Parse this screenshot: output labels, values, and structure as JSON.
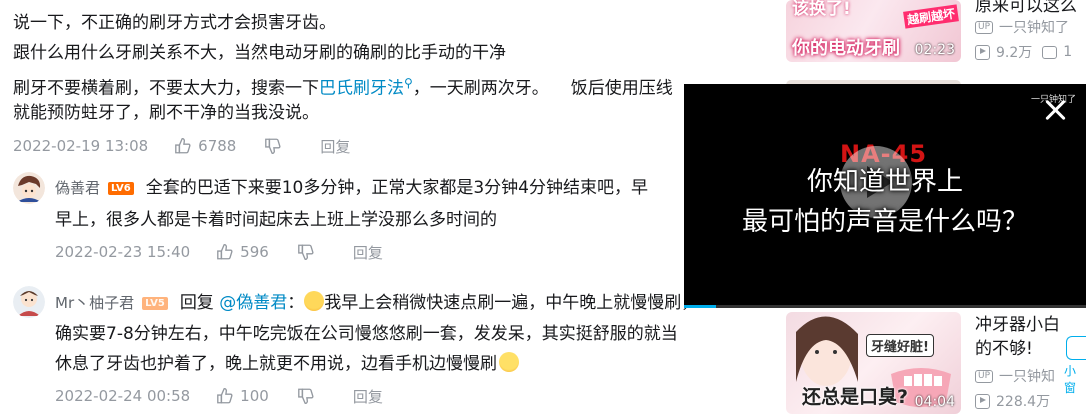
{
  "comment_tail": {
    "lines": [
      "说一下，不正确的刷牙方式才会损害牙齿。",
      "跟什么用什么牙刷关系不大，当然电动牙刷的确刷的比手动的干净",
      "就能预防蛀牙了，刷不干净的当我没说。"
    ],
    "line3_a": "刷牙不要横着刷，不要太大力，搜索一下",
    "line3_link": "巴氏刷牙法",
    "line3_b": "，一天刷两次牙。",
    "line3_c": "饭后使用压线",
    "date": "2022-02-19 13:08",
    "likes": "6788",
    "reply_label": "回复"
  },
  "replies": [
    {
      "username": "偽善君",
      "level": "LV6",
      "text_1": "全套的巴适下来要10多分钟，正常大家都是3分钟4分钟结束吧，早",
      "text_2": "早上，很多人都是卡着时间起床去上班上学没那么多时间的",
      "date": "2022-02-23 15:40",
      "likes": "596",
      "reply_label": "回复"
    },
    {
      "username": "Mr丶柚子君",
      "level": "LV5",
      "reply_prefix": "回复",
      "mention": "@偽善君",
      "colon": "：",
      "text_1": "我早上会稍微快速点刷一遍，中午晚上就慢慢刷，",
      "text_2": "确实要7-8分钟左右，中午吃完饭在公司慢悠悠刷一套，发发呆，其实挺舒服的就当",
      "text_3": "休息了牙齿也护着了，晚上就更不用说，边看手机边慢慢刷",
      "date": "2022-02-24 00:58",
      "likes": "100",
      "reply_label": "回复"
    }
  ],
  "recommendations": [
    {
      "title": "原来可以这么",
      "thumb_text_1": "该换了!",
      "thumb_text_2": "越刷越坏",
      "thumb_text_3": "你的电动牙刷",
      "duration": "02:23",
      "up_badge": "UP",
      "uploader": "一只钟知了",
      "views": "9.2万",
      "danmaku": "1"
    },
    {
      "title_1": "冲牙器小白",
      "title_2": "的不够!",
      "thumb_text_1": "牙缝好脏!",
      "thumb_text_2": "还总是口臭?",
      "duration": "04:04",
      "up_badge": "UP",
      "uploader": "一只钟知",
      "views": "228.4万",
      "side_label": "小窗"
    }
  ],
  "mini_player": {
    "watermark": "一只钟知了",
    "code_text": "NA-45",
    "subtitle_1": "你知道世界上",
    "subtitle_2": "最可怕的声音是什么吗？",
    "progress": 0.08
  },
  "colors": {
    "link": "#008ac5",
    "meta": "#9499a0",
    "level6": "#ff6c00",
    "level5": "#ffb37c",
    "thumb_accent": "#ff2d6f"
  }
}
